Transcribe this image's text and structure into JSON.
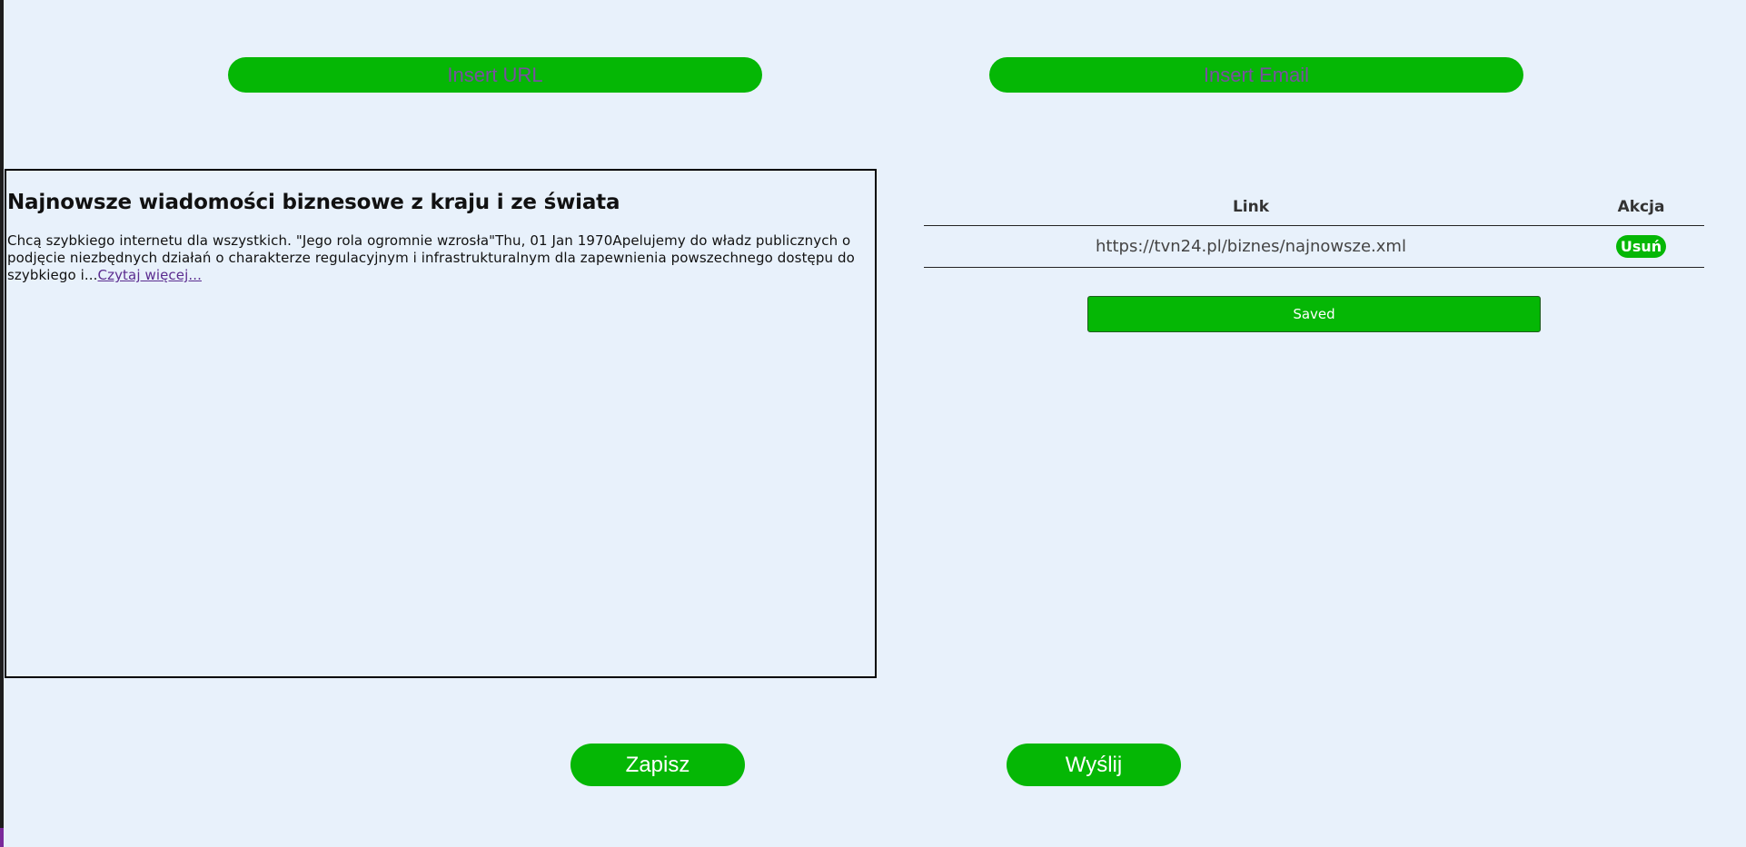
{
  "inputs": {
    "url_placeholder": "Insert URL",
    "email_placeholder": "Insert Email"
  },
  "news": {
    "title": "Najnowsze wiadomości biznesowe z kraju i ze świata",
    "body": "Chcą szybkiego internetu dla wszystkich. \"Jego rola ogromnie wzrosła\"Thu, 01 Jan 1970Apelujemy do władz publicznych o podjęcie niezbędnych działań o charakterze regulacyjnym i infrastrukturalnym dla zapewnienia powszechnego dostępu do szybkiego i...",
    "read_more": "Czytaj więcej..."
  },
  "table": {
    "headers": {
      "link": "Link",
      "action": "Akcja"
    },
    "rows": [
      {
        "link": "https://tvn24.pl/biznes/najnowsze.xml",
        "action_label": "Usuń"
      }
    ]
  },
  "saved_label": "Saved",
  "buttons": {
    "save": "Zapisz",
    "send": "Wyślij"
  },
  "colors": {
    "accent_green": "#05b705",
    "background": "#e8f1fb",
    "placeholder": "#7a4fa0"
  }
}
